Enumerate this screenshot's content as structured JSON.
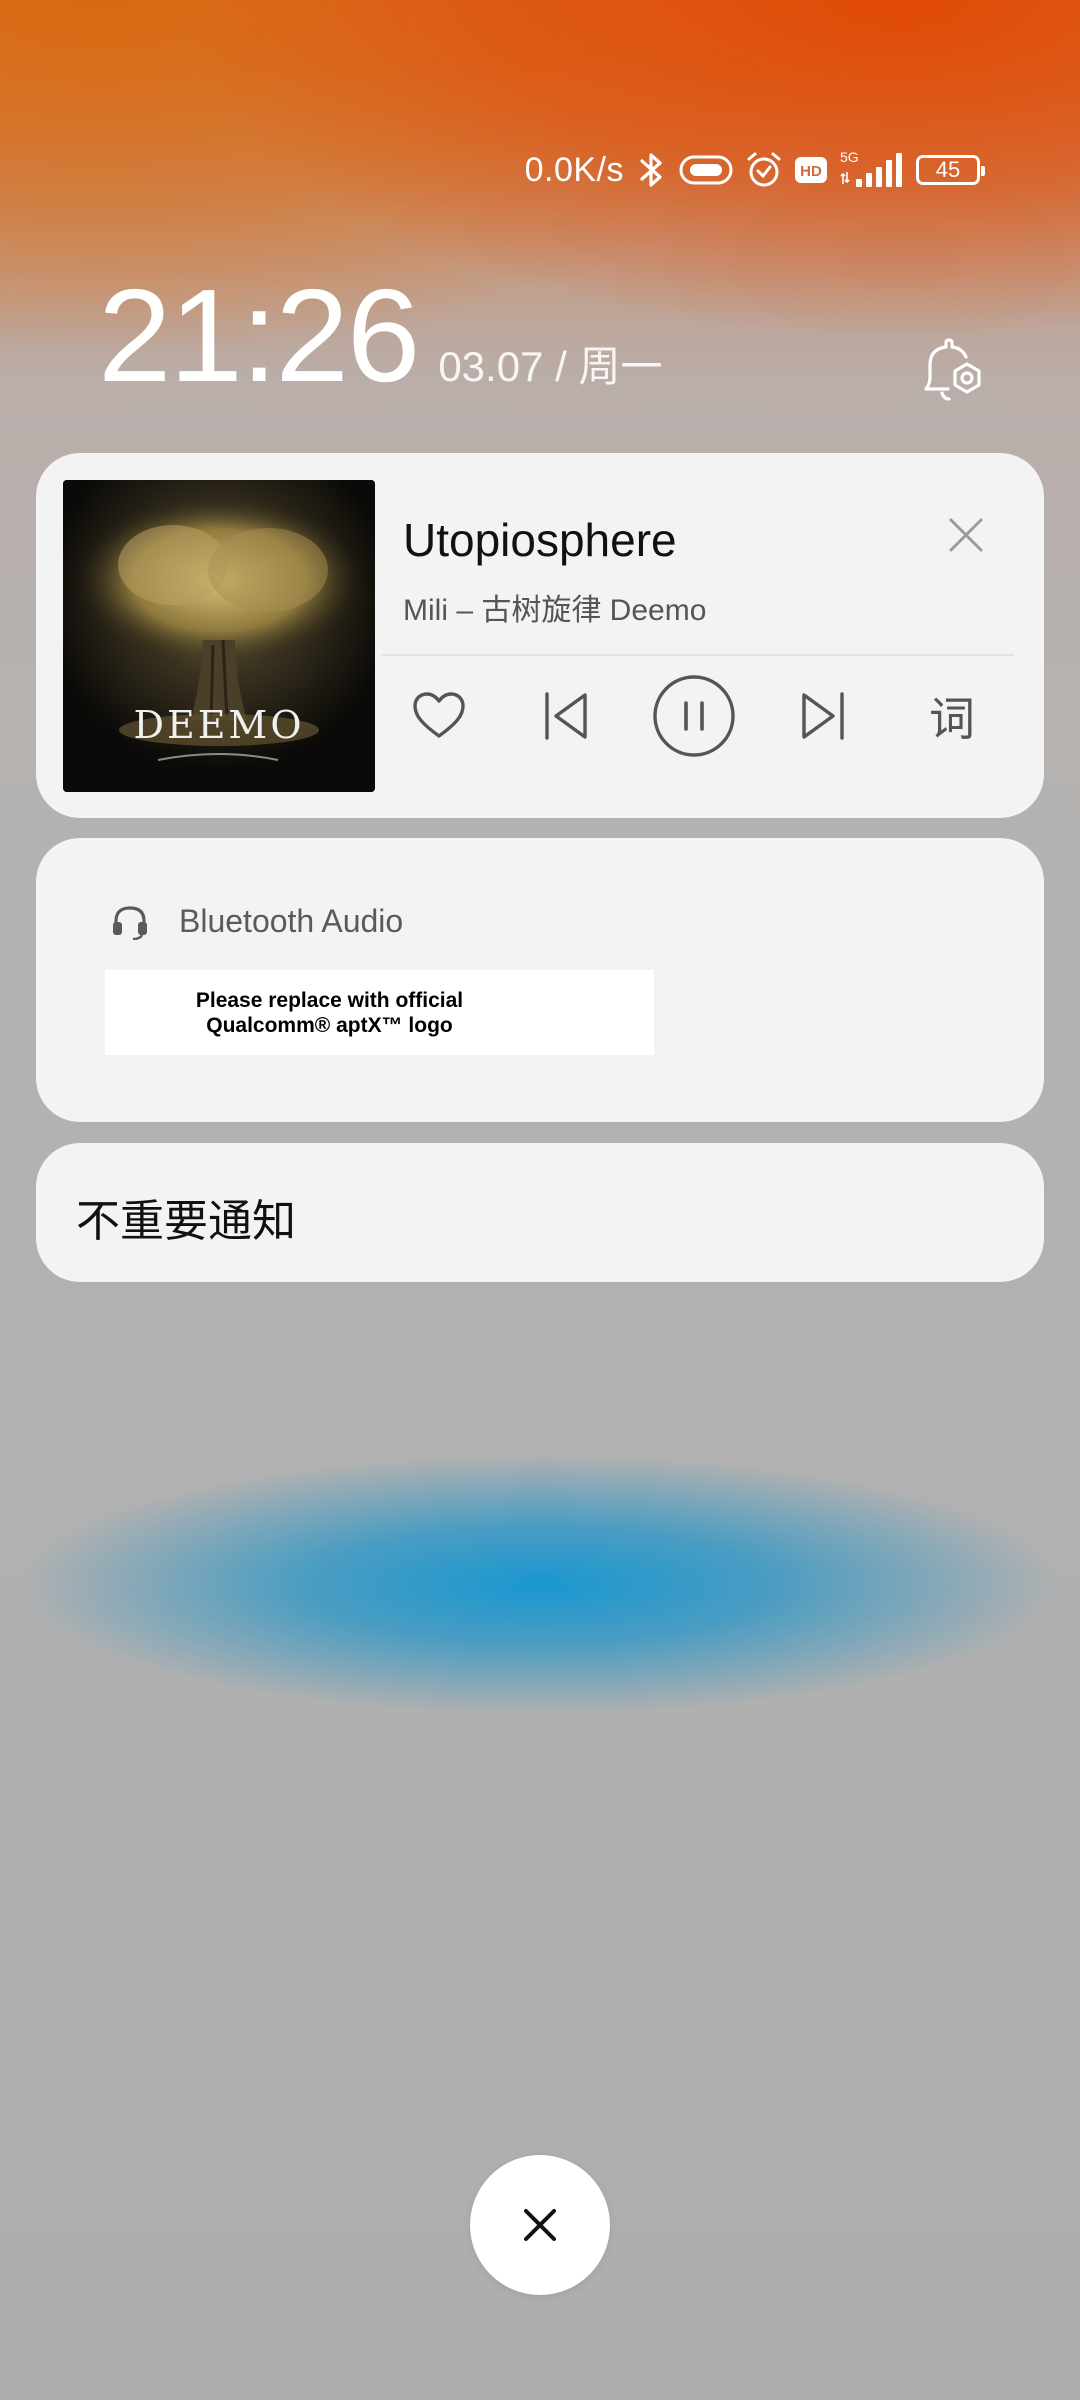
{
  "status_bar": {
    "network_speed": "0.0K/s",
    "icons": [
      "bluetooth-icon",
      "vibrate-icon",
      "alarm-icon",
      "hd-icon",
      "signal-5g-icon"
    ],
    "hd_label": "HD",
    "network_type": "5G",
    "battery_level": "45"
  },
  "lock": {
    "time": "21:26",
    "date": "03.07 / 周一"
  },
  "music": {
    "album_text": "DEEMO",
    "title": "Utopiosphere",
    "artist": "Mili – 古树旋律 Deemo",
    "lyrics_label": "词",
    "state": "playing"
  },
  "bluetooth": {
    "label": "Bluetooth Audio",
    "aptx_line1": "Please replace with official",
    "aptx_line2": "Qualcomm® aptX™ logo"
  },
  "unimportant": {
    "label": "不重要通知"
  },
  "colors": {
    "card_bg": "#f7f6f6",
    "accent_orange": "#e04a05",
    "blur_blue": "#1296d2"
  }
}
